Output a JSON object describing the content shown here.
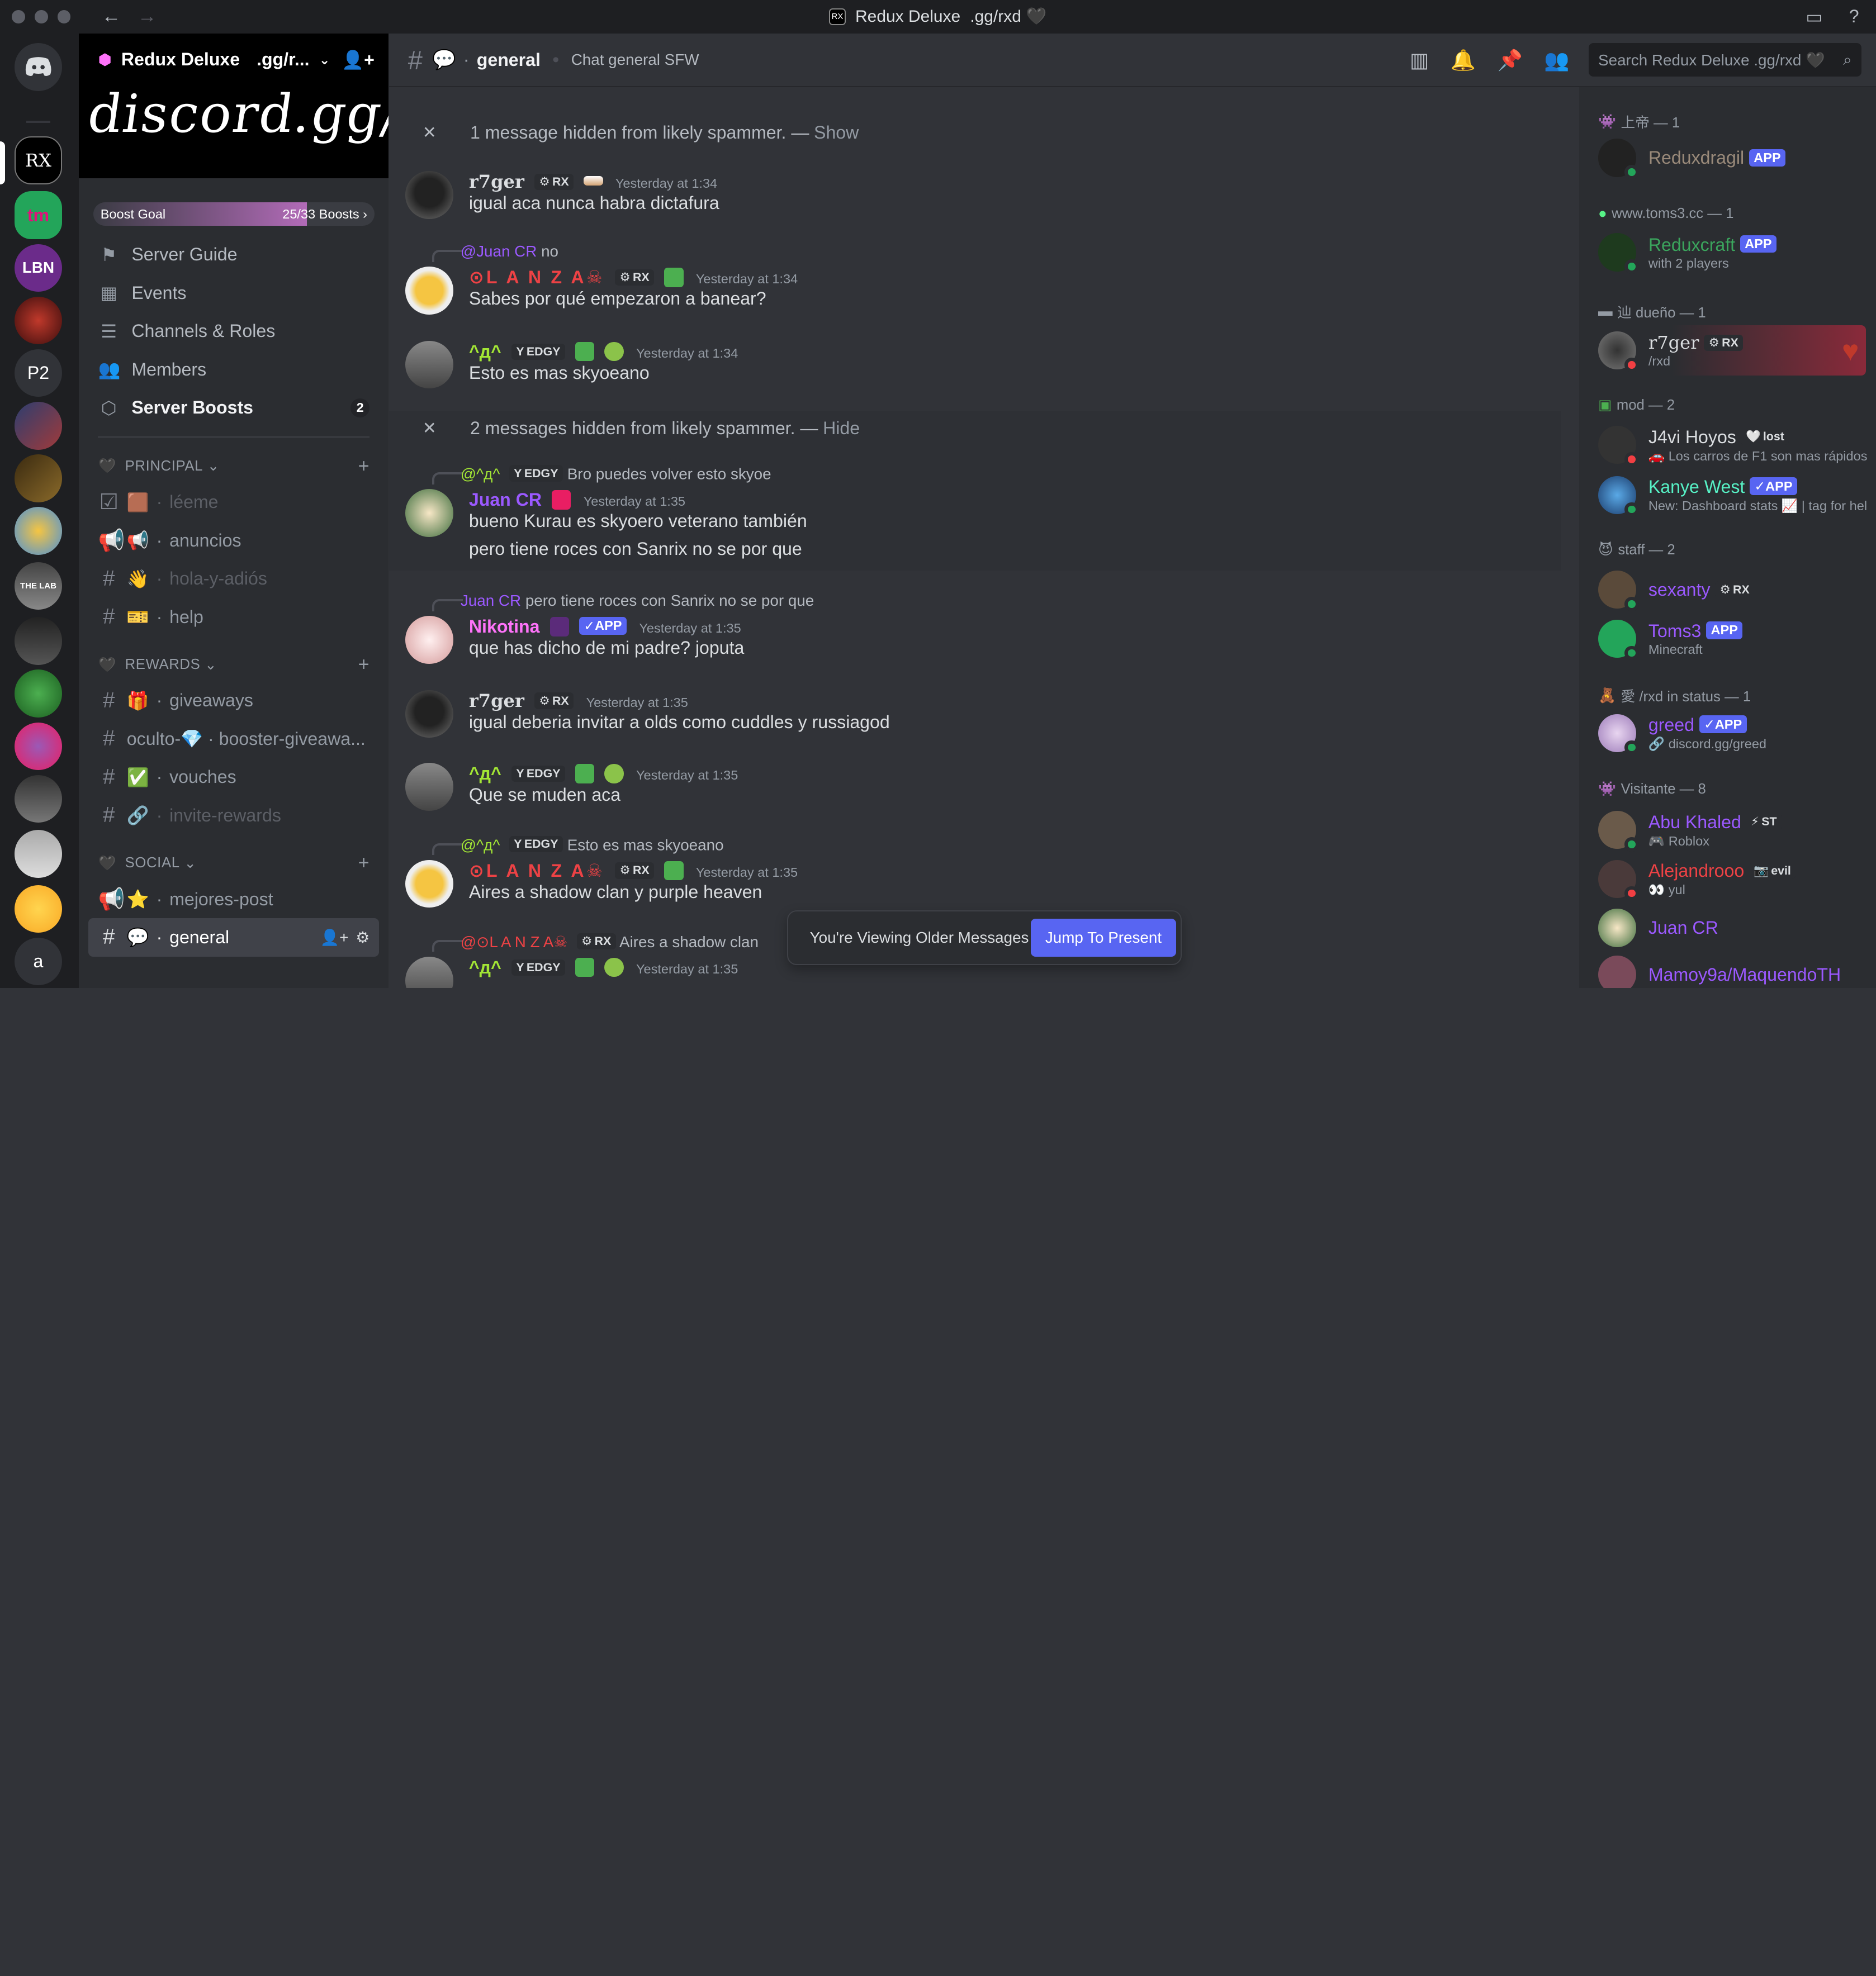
{
  "window": {
    "title": "Redux Deluxe",
    "title_suffix": ".gg/rxd 🖤"
  },
  "server": {
    "name": "Redux Deluxe",
    "vanity": ".gg/r...",
    "banner_text": "discord.gg/rxd",
    "boost_goal": {
      "label": "Boost Goal",
      "progress": "25/33 Boosts",
      "fraction": 0.76
    }
  },
  "rail": [
    "RX",
    "tm",
    "LBN",
    "P2",
    "a"
  ],
  "sidebar": {
    "items": [
      {
        "icon": "signpost-icon",
        "label": "Server Guide"
      },
      {
        "icon": "calendar-icon",
        "label": "Events"
      },
      {
        "icon": "channels-roles-icon",
        "label": "Channels & Roles"
      },
      {
        "icon": "members-icon",
        "label": "Members"
      },
      {
        "icon": "boost-icon",
        "label": "Server Boosts",
        "badge": "2"
      }
    ],
    "categories": [
      {
        "name": "PRINCIPAL",
        "channels": [
          {
            "label": "léeme",
            "emoji": "🟫"
          },
          {
            "label": "anuncios",
            "emoji": "📢"
          },
          {
            "label": "hola-y-adiós",
            "emoji": "👋"
          },
          {
            "label": "help",
            "emoji": "🎫"
          }
        ]
      },
      {
        "name": "REWARDS",
        "channels": [
          {
            "label": "giveaways",
            "emoji": "🎁"
          },
          {
            "label": "oculto-💎 · booster-giveawa...",
            "emoji": ""
          },
          {
            "label": "vouches",
            "emoji": "✅"
          },
          {
            "label": "invite-rewards",
            "emoji": "🔗"
          }
        ]
      },
      {
        "name": "SOCIAL",
        "channels": [
          {
            "label": "mejores-post",
            "emoji": "⭐"
          },
          {
            "label": "general",
            "emoji": "💬"
          }
        ]
      }
    ]
  },
  "channel": {
    "name": "general",
    "topic": "Chat general SFW",
    "search_placeholder": "Search Redux Deluxe  .gg/rxd 🖤"
  },
  "messages": {
    "hidden1": {
      "text": "1 message hidden from likely spammer. —",
      "action": "Show"
    },
    "hidden2": {
      "text": "2 messages hidden from likely spammer. —",
      "action": "Hide"
    },
    "m1": {
      "user": "r7ger",
      "tag": "RX",
      "time": "Yesterday at 1:34",
      "lines": [
        "igual aca nunca habra dictafura"
      ]
    },
    "m2": {
      "reply_user": "@Juan CR",
      "reply_text": "no",
      "user": "⊙L A N Z A☠",
      "tag": "RX",
      "time": "Yesterday at 1:34",
      "lines": [
        "Sabes por qué empezaron a banear?"
      ]
    },
    "m3": {
      "user": "^д^",
      "tag": "EDGY",
      "time": "Yesterday at 1:34",
      "lines": [
        "Esto es mas skyoeano"
      ]
    },
    "m4": {
      "reply_user": "@^д^",
      "reply_tag": "EDGY",
      "reply_text": "Bro puedes volver esto skyoe",
      "user": "Juan CR",
      "time": "Yesterday at 1:35",
      "lines": [
        "bueno Kurau es skyoero veterano también",
        "pero tiene roces con Sanrix no se por que"
      ]
    },
    "m5": {
      "reply_user": "Juan CR",
      "reply_text": "pero tiene roces con Sanrix no se por que",
      "user": "Nikotina",
      "app": "APP",
      "time": "Yesterday at 1:35",
      "lines": [
        "que has dicho de mi padre? joputa"
      ]
    },
    "m6": {
      "user": "r7ger",
      "tag": "RX",
      "time": "Yesterday at 1:35",
      "lines": [
        "igual deberia invitar a olds como cuddles y russiagod"
      ]
    },
    "m7": {
      "user": "^д^",
      "tag": "EDGY",
      "time": "Yesterday at 1:35",
      "lines": [
        "Que se muden aca"
      ]
    },
    "m8": {
      "reply_user": "@^д^",
      "reply_tag": "EDGY",
      "reply_text": "Esto es mas skyoeano",
      "user": "⊙L A N Z A☠",
      "tag": "RX",
      "time": "Yesterday at 1:35",
      "lines": [
        "Aires a shadow clan y purple heaven"
      ]
    },
    "m9": {
      "reply_user": "@⊙L A N Z A☠",
      "reply_tag": "RX",
      "reply_text": "Aires a shadow clan",
      "user": "^д^",
      "tag": "EDGY",
      "time": "Yesterday at 1:35",
      "lines": [
        ""
      ]
    }
  },
  "older_bar": {
    "text": "You're Viewing Older Messages",
    "button": "Jump To Present"
  },
  "members": {
    "groups": [
      {
        "label": "上帝 — 1"
      },
      {
        "label": "www.toms3.cc — 1"
      },
      {
        "label": "辿 dueño — 1"
      },
      {
        "label": "mod — 2"
      },
      {
        "label": "staff — 2"
      },
      {
        "label": "愛 /rxd in status — 1"
      },
      {
        "label": "Visitante — 8"
      }
    ],
    "list": [
      {
        "name": "Reduxdragil",
        "app": "APP",
        "sub": ""
      },
      {
        "name": "Reduxcraft",
        "app": "APP",
        "sub": "with 2 players"
      },
      {
        "name": "r7ger",
        "tag": "RX",
        "sub": "/rxd"
      },
      {
        "name": "J4vi Hoyos",
        "tag": "lost",
        "sub": "🚗 Los carros de F1 son mas rápidos"
      },
      {
        "name": "Kanye West",
        "app": "APP",
        "sub": "New: Dashboard stats 📈 | tag for hel"
      },
      {
        "name": "sexanty",
        "tag": "RX",
        "sub": ""
      },
      {
        "name": "Toms3",
        "app": "APP",
        "sub": "Minecraft"
      },
      {
        "name": "greed",
        "app": "APP",
        "sub": "🔗 discord.gg/greed"
      },
      {
        "name": "Abu Khaled",
        "tag": "ST",
        "sub": "🎮 Roblox"
      },
      {
        "name": "Alejandrooo",
        "tag": "evil",
        "sub": "👀 yul"
      },
      {
        "name": "Juan CR",
        "sub": ""
      },
      {
        "name": "Mamoy9a/MaquendoTH",
        "sub": ""
      }
    ]
  },
  "colors": {
    "accent": "#5865f2",
    "green": "#57f287",
    "lanza_red": "#ed4245",
    "juan_purple": "#9b59ff",
    "nikotina_pink": "#ff73fa",
    "edgy_green": "#a3e635"
  }
}
